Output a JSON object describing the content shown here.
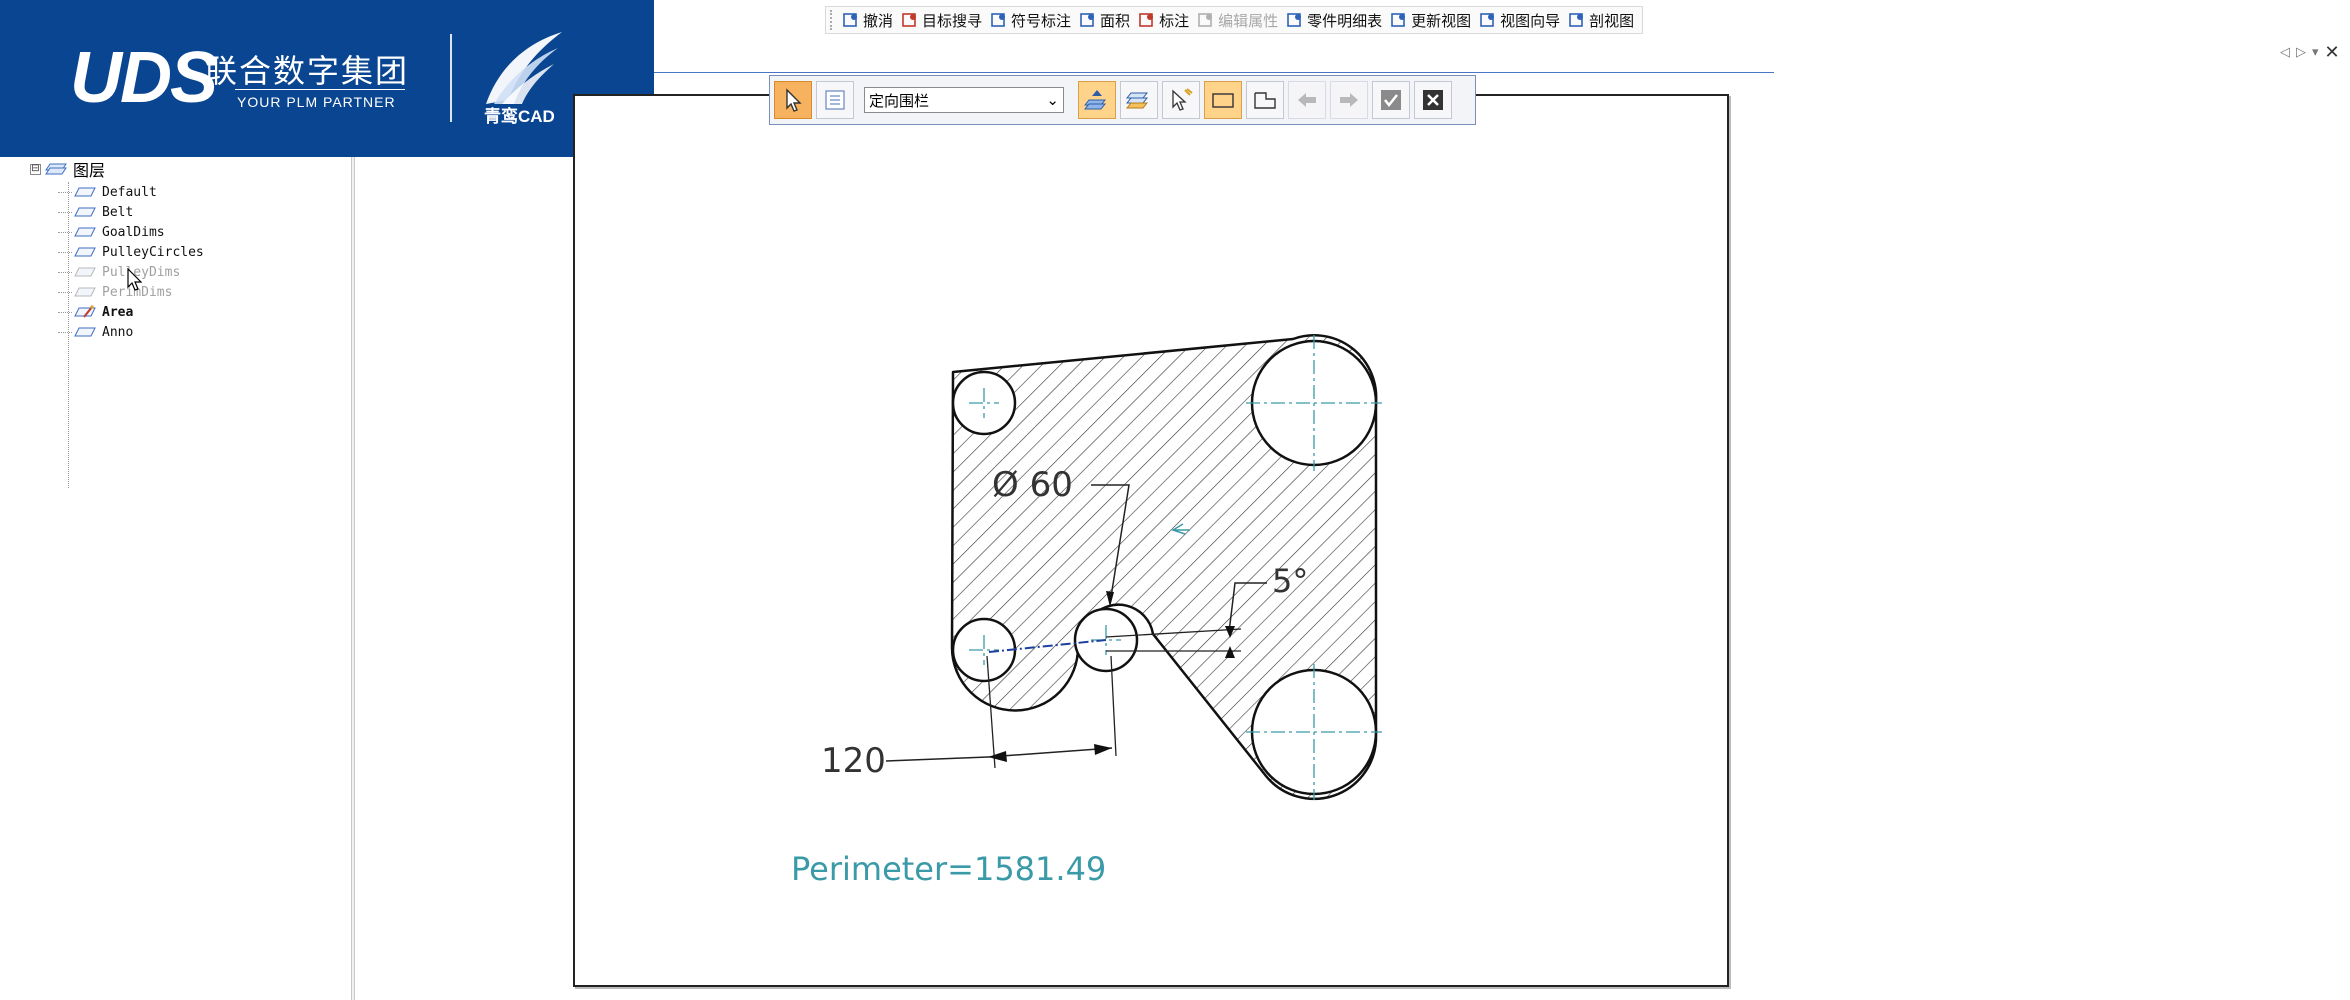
{
  "brand": {
    "logo": "UDS",
    "company_cn": "联合数字集团",
    "tagline": "YOUR PLM PARTNER",
    "product": "青鸾CAD"
  },
  "ribbon": {
    "items": [
      {
        "label": "撤消",
        "icon": "undo-icon",
        "enabled": true
      },
      {
        "label": "目标搜寻",
        "icon": "target-search-icon",
        "enabled": true
      },
      {
        "label": "符号标注",
        "icon": "symbol-annotation-icon",
        "enabled": true
      },
      {
        "label": "面积",
        "icon": "area-icon",
        "enabled": true
      },
      {
        "label": "标注",
        "icon": "annotation-icon",
        "enabled": true
      },
      {
        "label": "编辑属性",
        "icon": "edit-properties-icon",
        "enabled": false
      },
      {
        "label": "零件明细表",
        "icon": "parts-list-icon",
        "enabled": true
      },
      {
        "label": "更新视图",
        "icon": "update-view-icon",
        "enabled": true
      },
      {
        "label": "视图向导",
        "icon": "view-wizard-icon",
        "enabled": true
      },
      {
        "label": "剖视图",
        "icon": "section-view-icon",
        "enabled": true
      }
    ]
  },
  "select_bar": {
    "fence_mode": "定向围栏"
  },
  "tree": {
    "root": "图层",
    "root_state": "⊟",
    "layers": [
      {
        "name": "Default",
        "state": "normal"
      },
      {
        "name": "Belt",
        "state": "normal"
      },
      {
        "name": "GoalDims",
        "state": "normal"
      },
      {
        "name": "PulleyCircles",
        "state": "normal"
      },
      {
        "name": "PulleyDims",
        "state": "hidden"
      },
      {
        "name": "PerimDims",
        "state": "hidden"
      },
      {
        "name": "Area",
        "state": "active"
      },
      {
        "name": "Anno",
        "state": "normal"
      }
    ]
  },
  "drawing": {
    "dim_diameter": "Ø 60",
    "dim_angle": "5°",
    "dim_length": "120",
    "perimeter": "Perimeter=1581.49"
  },
  "colors": {
    "brand_blue": "#0a4592",
    "perimeter_text": "#3a9aa8",
    "centerline": "#3a9aa8",
    "active_button": "#f6b25e"
  }
}
